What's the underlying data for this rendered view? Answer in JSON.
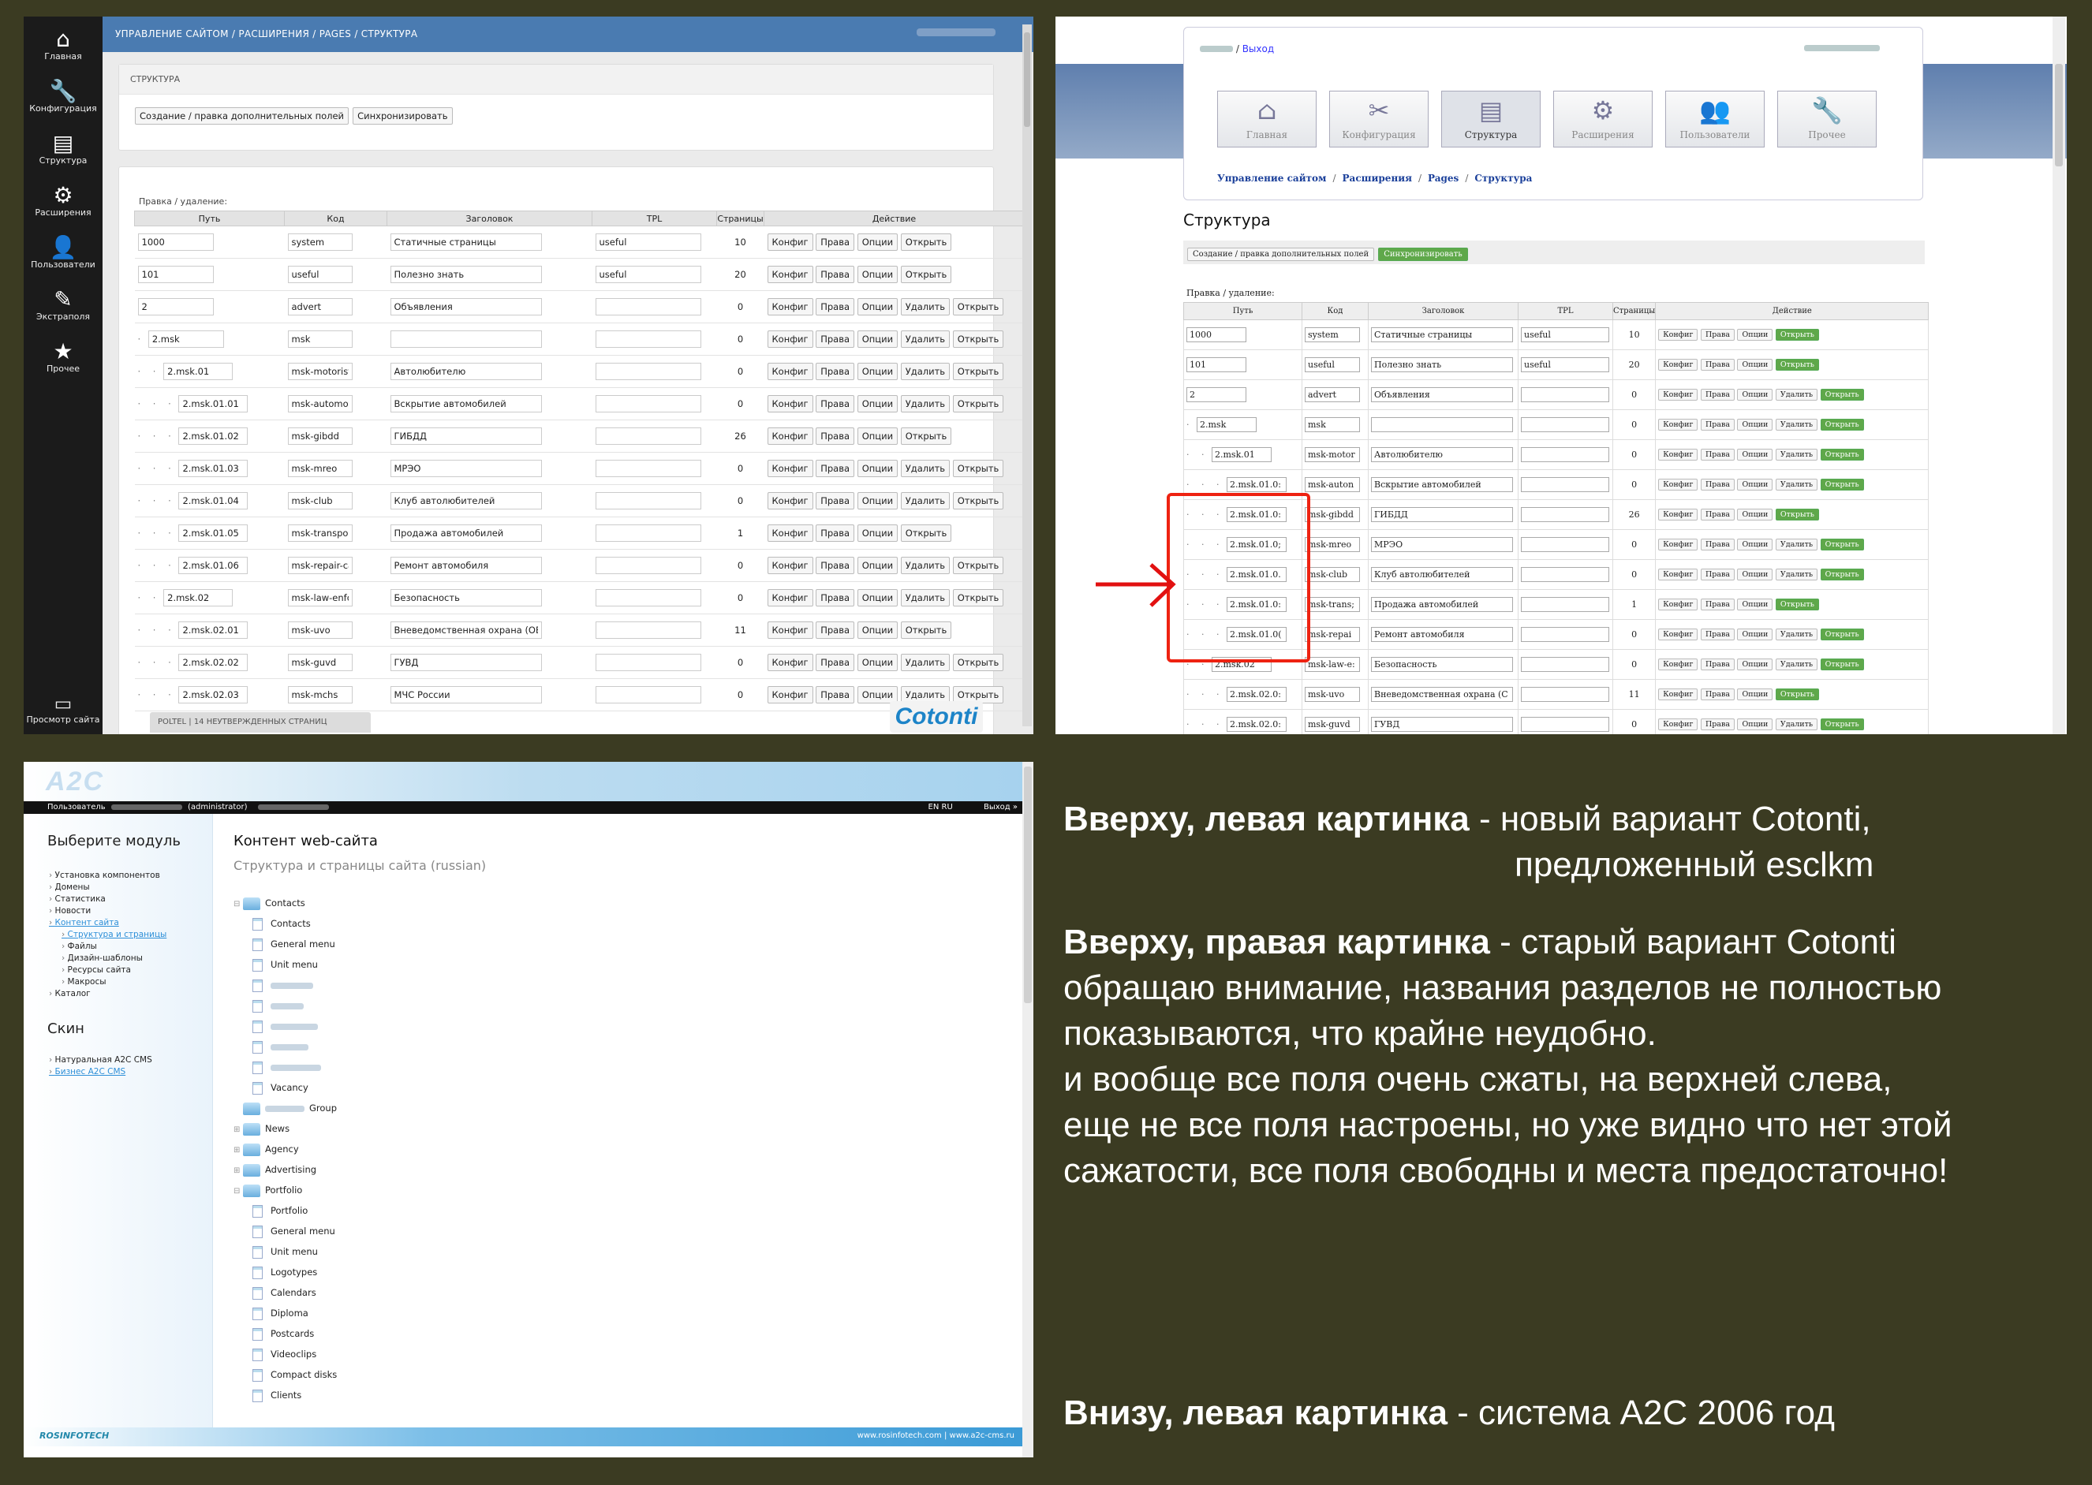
{
  "p1": {
    "sidebar": [
      {
        "icon": "home-icon",
        "glyph": "⌂",
        "label": "Главная"
      },
      {
        "icon": "wrench-icon",
        "glyph": "🔧",
        "label": "Конфигурация"
      },
      {
        "icon": "structure-icon",
        "glyph": "▤",
        "label": "Структура"
      },
      {
        "icon": "gear-icon",
        "glyph": "⚙",
        "label": "Расширения"
      },
      {
        "icon": "users-icon",
        "glyph": "👤",
        "label": "Пользователи"
      },
      {
        "icon": "pencil-icon",
        "glyph": "✎",
        "label": "Экстраполя"
      },
      {
        "icon": "star-icon",
        "glyph": "★",
        "label": "Прочее"
      }
    ],
    "view_site": {
      "glyph": "▭",
      "label": "Просмотр сайта"
    },
    "breadcrumb": "УПРАВЛЕНИЕ САЙТОМ / РАСШИРЕНИЯ / PAGES / СТРУКТУРА",
    "card_title": "СТРУКТУРА",
    "btn_extra": "Создание / правка дополнительных полей",
    "btn_sync": "Синхронизировать",
    "edit_label": "Правка / удаление:",
    "headers": [
      "Путь",
      "Код",
      "Заголовок",
      "TPL",
      "Страницы",
      "Действие"
    ],
    "actions": {
      "config": "Конфиг",
      "rights": "Права",
      "options": "Опции",
      "delete": "Удалить",
      "open": "Открыть"
    },
    "rows": [
      {
        "path": "1000",
        "code": "system",
        "title": "Статичные страницы",
        "tpl": "useful",
        "pages": "10",
        "del": false
      },
      {
        "path": "101",
        "code": "useful",
        "title": "Полезно знать",
        "tpl": "useful",
        "pages": "20",
        "del": false
      },
      {
        "path": "2",
        "code": "advert",
        "title": "Объявления",
        "tpl": "",
        "pages": "0",
        "del": true
      },
      {
        "path": "2.msk",
        "code": "msk",
        "title": "",
        "tpl": "",
        "pages": "0",
        "del": true
      },
      {
        "path": "2.msk.01",
        "code": "msk-motorist",
        "title": "Автолюбителю",
        "tpl": "",
        "pages": "0",
        "del": true
      },
      {
        "path": "2.msk.01.01",
        "code": "msk-automot",
        "title": "Вскрытие автомобилей",
        "tpl": "",
        "pages": "0",
        "del": true
      },
      {
        "path": "2.msk.01.02",
        "code": "msk-gibdd",
        "title": "ГИБДД",
        "tpl": "",
        "pages": "26",
        "del": false
      },
      {
        "path": "2.msk.01.03",
        "code": "msk-mreo",
        "title": "МРЭО",
        "tpl": "",
        "pages": "0",
        "del": true
      },
      {
        "path": "2.msk.01.04",
        "code": "msk-club",
        "title": "Клуб автолюбителей",
        "tpl": "",
        "pages": "0",
        "del": true
      },
      {
        "path": "2.msk.01.05",
        "code": "msk-transpor",
        "title": "Продажа автомобилей",
        "tpl": "",
        "pages": "1",
        "del": false
      },
      {
        "path": "2.msk.01.06",
        "code": "msk-repair-ca",
        "title": "Ремонт автомобиля",
        "tpl": "",
        "pages": "0",
        "del": true
      },
      {
        "path": "2.msk.02",
        "code": "msk-law-enfo",
        "title": "Безопасность",
        "tpl": "",
        "pages": "0",
        "del": true
      },
      {
        "path": "2.msk.02.01",
        "code": "msk-uvo",
        "title": "Вневедомственная охрана (ОВС",
        "tpl": "",
        "pages": "11",
        "del": false
      },
      {
        "path": "2.msk.02.02",
        "code": "msk-guvd",
        "title": "ГУВД",
        "tpl": "",
        "pages": "0",
        "del": true
      },
      {
        "path": "2.msk.02.03",
        "code": "msk-mchs",
        "title": "МЧС России",
        "tpl": "",
        "pages": "0",
        "del": true
      }
    ],
    "status": "POLTEL | 14 НЕУТВЕРЖДЕННЫХ СТРАНИЦ",
    "logo": "Cotonti"
  },
  "p2": {
    "logout": "Выход",
    "nav": [
      {
        "icon": "home-icon",
        "glyph": "⌂",
        "label": "Главная"
      },
      {
        "icon": "tools-icon",
        "glyph": "✂",
        "label": "Конфигурация"
      },
      {
        "icon": "folder-icon",
        "glyph": "▤",
        "label": "Структура",
        "active": true
      },
      {
        "icon": "gear-icon",
        "glyph": "⚙",
        "label": "Расширения"
      },
      {
        "icon": "users-icon",
        "glyph": "👥",
        "label": "Пользователи"
      },
      {
        "icon": "wrench-icon",
        "glyph": "🔧",
        "label": "Прочее"
      }
    ],
    "crumbs": [
      "Управление сайтом",
      "Расширения",
      "Pages",
      "Структура"
    ],
    "title": "Структура",
    "btn_extra": "Создание / правка дополнительных полей",
    "btn_sync": "Синхронизировать",
    "edit_label": "Правка / удаление:",
    "headers": [
      "Путь",
      "Код",
      "Заголовок",
      "TPL",
      "Страницы",
      "Действие"
    ],
    "actions": {
      "config": "Конфиг",
      "rights": "Права",
      "options": "Опции",
      "delete": "Удалить",
      "open": "Открыть"
    },
    "rows": [
      {
        "depth": 0,
        "path": "1000",
        "code": "system",
        "title": "Статичные страницы",
        "tpl": "useful",
        "pages": "10",
        "del": false
      },
      {
        "depth": 0,
        "path": "101",
        "code": "useful",
        "title": "Полезно знать",
        "tpl": "useful",
        "pages": "20",
        "del": false
      },
      {
        "depth": 0,
        "path": "2",
        "code": "advert",
        "title": "Объявления",
        "tpl": "",
        "pages": "0",
        "del": true
      },
      {
        "depth": 1,
        "path": "2.msk",
        "code": "msk",
        "title": "",
        "tpl": "",
        "pages": "0",
        "del": true
      },
      {
        "depth": 2,
        "path": "2.msk.01",
        "code": "msk-motor",
        "title": "Автолюбителю",
        "tpl": "",
        "pages": "0",
        "del": true
      },
      {
        "depth": 3,
        "path": "2.msk.01.0:",
        "code": "msk-auton",
        "title": "Вскрытие автомобилей",
        "tpl": "",
        "pages": "0",
        "del": true
      },
      {
        "depth": 3,
        "path": "2.msk.01.0:",
        "code": "msk-gibdd",
        "title": "ГИБДД",
        "tpl": "",
        "pages": "26",
        "del": false
      },
      {
        "depth": 3,
        "path": "2.msk.01.0;",
        "code": "msk-mreo",
        "title": "МРЭО",
        "tpl": "",
        "pages": "0",
        "del": true
      },
      {
        "depth": 3,
        "path": "2.msk.01.0.",
        "code": "msk-club",
        "title": "Клуб автолюбителей",
        "tpl": "",
        "pages": "0",
        "del": true
      },
      {
        "depth": 3,
        "path": "2.msk.01.0:",
        "code": "msk-trans;",
        "title": "Продажа автомобилей",
        "tpl": "",
        "pages": "1",
        "del": false
      },
      {
        "depth": 3,
        "path": "2.msk.01.0(",
        "code": "msk-repai",
        "title": "Ремонт автомобиля",
        "tpl": "",
        "pages": "0",
        "del": true
      },
      {
        "depth": 2,
        "path": "2.msk.02",
        "code": "msk-law-e:",
        "title": "Безопасность",
        "tpl": "",
        "pages": "0",
        "del": true
      },
      {
        "depth": 3,
        "path": "2.msk.02.0:",
        "code": "msk-uvo",
        "title": "Вневедомственная охрана (С",
        "tpl": "",
        "pages": "11",
        "del": false
      },
      {
        "depth": 3,
        "path": "2.msk.02.0:",
        "code": "msk-guvd",
        "title": "ГУВД",
        "tpl": "",
        "pages": "0",
        "del": true
      }
    ]
  },
  "p3": {
    "logo": "A2C",
    "user_label": "Пользователь",
    "role": "(administrator)",
    "lang": "EN RU",
    "logout": "Выход »",
    "left_title": "Выберите модуль",
    "modules": [
      {
        "t": "Установка компонентов",
        "c": ""
      },
      {
        "t": "Домены",
        "c": ""
      },
      {
        "t": "Статистика",
        "c": ""
      },
      {
        "t": "Новости",
        "c": ""
      },
      {
        "t": "Контент сайта",
        "c": "link"
      },
      {
        "t": "Структура и страницы",
        "c": "link sub"
      },
      {
        "t": "Файлы",
        "c": "sub"
      },
      {
        "t": "Дизайн-шаблоны",
        "c": "sub"
      },
      {
        "t": "Ресурсы сайта",
        "c": "sub"
      },
      {
        "t": "Макросы",
        "c": "sub"
      },
      {
        "t": "Каталог",
        "c": ""
      }
    ],
    "skin_title": "Скин",
    "skins": [
      {
        "t": "Натуральная A2C CMS",
        "c": ""
      },
      {
        "t": "Бизнес A2C CMS",
        "c": "link"
      }
    ],
    "main_title": "Контент web-сайта",
    "main_sub": "Структура и страницы сайта (russian)",
    "tree": [
      {
        "l": 0,
        "t": "Contacts",
        "k": "folder",
        "pm": "⊟"
      },
      {
        "l": 1,
        "t": "Contacts",
        "k": "doc"
      },
      {
        "l": 1,
        "t": "General menu",
        "k": "doc"
      },
      {
        "l": 1,
        "t": "Unit menu",
        "k": "doc"
      },
      {
        "l": 1,
        "t": "",
        "k": "doc",
        "w": 54
      },
      {
        "l": 1,
        "t": "",
        "k": "doc",
        "w": 42
      },
      {
        "l": 1,
        "t": "",
        "k": "doc",
        "w": 60
      },
      {
        "l": 1,
        "t": "",
        "k": "doc",
        "w": 48
      },
      {
        "l": 1,
        "t": "",
        "k": "doc",
        "w": 64
      },
      {
        "l": 1,
        "t": "Vacancy",
        "k": "doc"
      },
      {
        "l": 0,
        "t": "Group",
        "k": "folder",
        "pm": "",
        "w": 50
      },
      {
        "l": 0,
        "t": "News",
        "k": "folder",
        "pm": "⊞"
      },
      {
        "l": 0,
        "t": "Agency",
        "k": "folder",
        "pm": "⊞"
      },
      {
        "l": 0,
        "t": "Advertising",
        "k": "folder",
        "pm": "⊞"
      },
      {
        "l": 0,
        "t": "Portfolio",
        "k": "folder",
        "pm": "⊟"
      },
      {
        "l": 1,
        "t": "Portfolio",
        "k": "doc"
      },
      {
        "l": 1,
        "t": "General menu",
        "k": "doc"
      },
      {
        "l": 1,
        "t": "Unit menu",
        "k": "doc"
      },
      {
        "l": 1,
        "t": "Logotypes",
        "k": "doc"
      },
      {
        "l": 1,
        "t": "Calendars",
        "k": "doc"
      },
      {
        "l": 1,
        "t": "Diploma",
        "k": "doc"
      },
      {
        "l": 1,
        "t": "Postcards",
        "k": "doc"
      },
      {
        "l": 1,
        "t": "Videoclips",
        "k": "doc"
      },
      {
        "l": 1,
        "t": "Compact disks",
        "k": "doc"
      },
      {
        "l": 1,
        "t": "Clients",
        "k": "doc"
      }
    ],
    "footer_logo": "ROSINFOTECH",
    "footer_links": "www.rosinfotech.com  |  www.a2c-cms.ru"
  },
  "notes": {
    "n1_bold": "Вверху, левая картинка",
    "n1_text": " - новый вариант Cotonti,",
    "n1_line2": "предложенный esclkm",
    "n2_bold": "Вверху, правая картинка",
    "n2_text": " - старый вариант Cotonti",
    "n2_lines": [
      "обращаю внимание, названия разделов не полностью",
      "показываются, что крайне неудобно.",
      "и вообще все поля очень сжаты, на верхней слева,",
      "еще не все поля настроены, но уже видно что нет этой",
      "сажатости, все поля свободны и места предостаточно!"
    ],
    "n3_bold": "Внизу, левая картинка",
    "n3_text": " - система А2С 2006 год"
  },
  "colors": {
    "background": "#3b3b22",
    "highlight": "#e21111",
    "p1_topbar": "#4a7bb1",
    "green_button": "#5fa84a"
  }
}
